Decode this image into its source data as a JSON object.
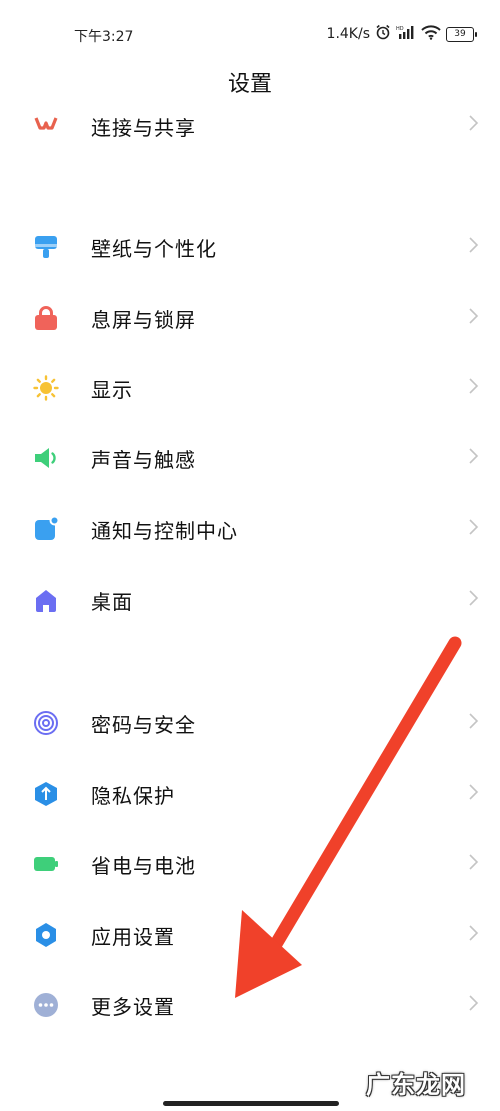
{
  "status_bar": {
    "time": "下午3:27",
    "network_speed": "1.4K/s",
    "battery_level": "39",
    "icons": [
      "alarm-icon",
      "hd-signal-icon",
      "wifi-icon",
      "battery-icon"
    ]
  },
  "header": {
    "title": "设置"
  },
  "settings": {
    "partial_item": {
      "label": "连接与共享",
      "icon": "connection-share-icon",
      "color": "#e8624e"
    },
    "group1": [
      {
        "label": "壁纸与个性化",
        "icon": "wallpaper-icon",
        "color": "#3aa0f0"
      },
      {
        "label": "息屏与锁屏",
        "icon": "lock-icon",
        "color": "#f0635a"
      },
      {
        "label": "显示",
        "icon": "sun-icon",
        "color": "#f7c234"
      },
      {
        "label": "声音与触感",
        "icon": "speaker-icon",
        "color": "#3ecf7a"
      },
      {
        "label": "通知与控制中心",
        "icon": "notification-icon",
        "color": "#3aa0f0"
      },
      {
        "label": "桌面",
        "icon": "home-icon",
        "color": "#6b6ef2"
      }
    ],
    "group2": [
      {
        "label": "密码与安全",
        "icon": "fingerprint-icon",
        "color": "#6b6ef2"
      },
      {
        "label": "隐私保护",
        "icon": "privacy-shield-icon",
        "color": "#2a8fe6"
      },
      {
        "label": "省电与电池",
        "icon": "battery-saver-icon",
        "color": "#3ecf7a"
      },
      {
        "label": "应用设置",
        "icon": "gear-icon",
        "color": "#2a8fe6"
      },
      {
        "label": "更多设置",
        "icon": "more-icon",
        "color": "#9fb0d6"
      }
    ]
  },
  "annotation": {
    "arrow_color": "#f0412a",
    "points_to": "更多设置"
  },
  "watermark": {
    "text": "广东龙网"
  }
}
